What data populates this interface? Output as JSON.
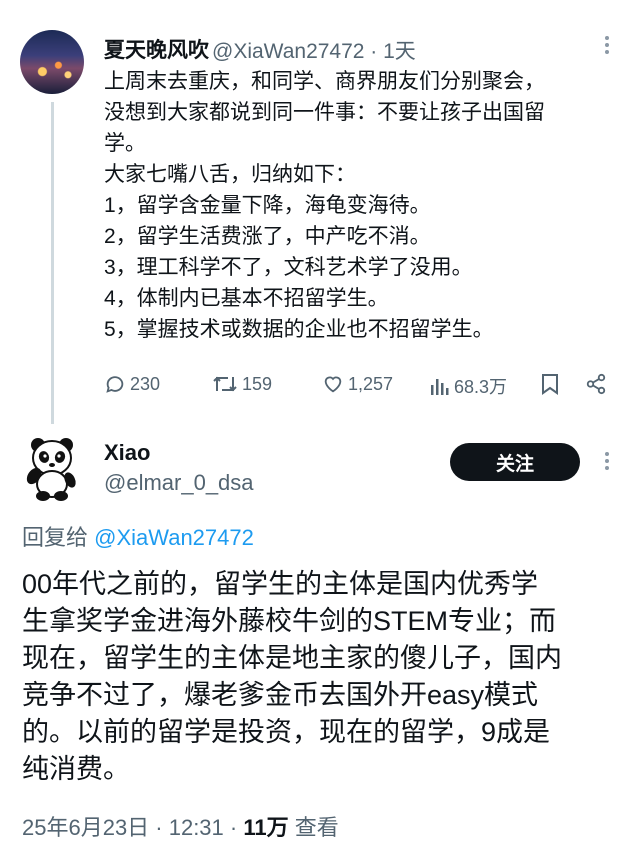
{
  "tweet": {
    "author_name": "夏天晚风吹",
    "author_handle": "@XiaWan27472 · 1天",
    "text": "上周末去重庆，和同学、商界朋友们分别聚会，\n没想到大家都说到同一件事：不要让孩子出国留\n学。\n大家七嘴八舌，归纳如下：\n1，留学含金量下降，海龟变海待。\n2，留学生活费涨了，中产吃不消。\n3，理工科学不了，文科艺术学了没用。\n4，体制内已基本不招留学生。\n5，掌握技术或数据的企业也不招留学生。",
    "stats": {
      "replies": "230",
      "retweets": "159",
      "likes": "1,257",
      "views": "68.3万"
    },
    "icons": [
      "reply-icon",
      "retweet-icon",
      "like-icon",
      "views-icon",
      "bookmark-icon",
      "share-icon",
      "more-icon"
    ]
  },
  "reply": {
    "author_name": "Xiao",
    "author_handle": "@elmar_0_dsa",
    "follow_label": "关注",
    "reply_prefix": "回复给 ",
    "reply_mention": "@XiaWan27472",
    "text": "00年代之前的，留学生的主体是国内优秀学\n生拿奖学金进海外藤校牛剑的STEM专业；而\n现在，留学生的主体是地主家的傻儿子，国内\n竞争不过了，爆老爹金币去国外开easy模式\n的。以前的留学是投资，现在的留学，9成是\n纯消费。",
    "meta_prefix": "25年6月23日 · 12:31 · ",
    "meta_views": "11万",
    "meta_suffix": " 查看"
  },
  "colors": {
    "text": "#0f1419",
    "secondary": "#536471",
    "link": "#1d9bf0",
    "button": "#0f1419"
  }
}
